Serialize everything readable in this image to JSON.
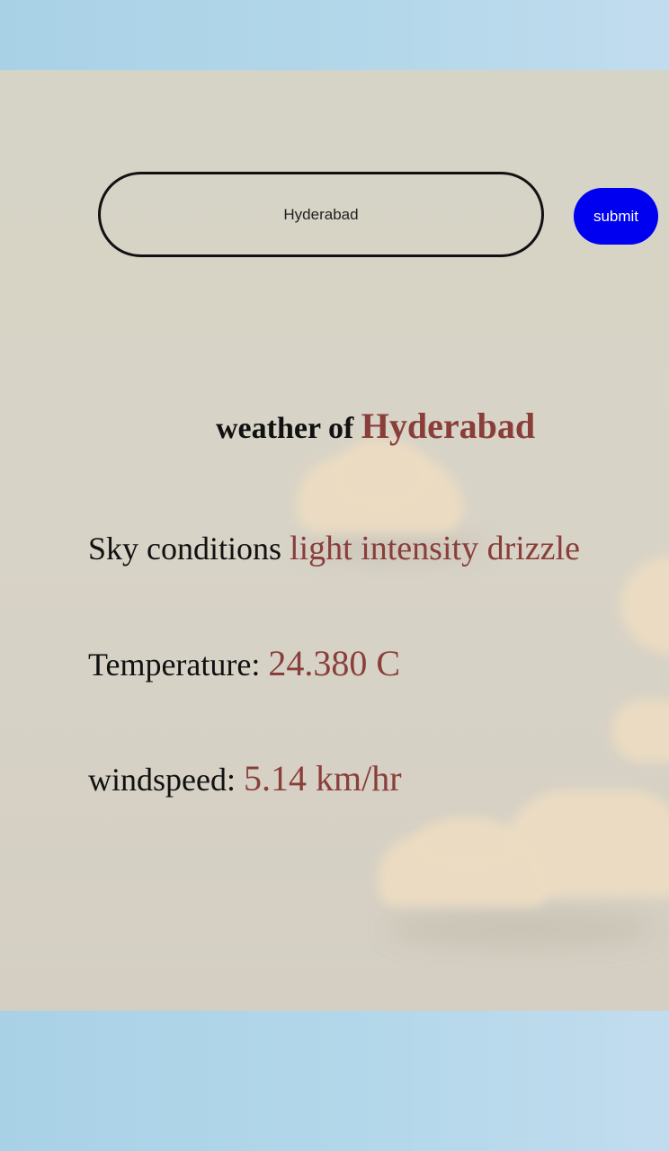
{
  "search": {
    "value": "Hyderabad",
    "submit_label": "submit"
  },
  "weather": {
    "heading_prefix": "weather of",
    "city": "Hyderabad",
    "sky_label": "Sky conditions",
    "sky_value": "light intensity drizzle",
    "temperature_label": "Temperature:",
    "temperature_value": "24.380 C",
    "windspeed_label": "windspeed:",
    "windspeed_value": "5.14 km/hr"
  },
  "colors": {
    "accent": "#8a3e3a",
    "button": "#0000f0",
    "card": "#d6d4c6",
    "background": "#b4d8ea"
  }
}
